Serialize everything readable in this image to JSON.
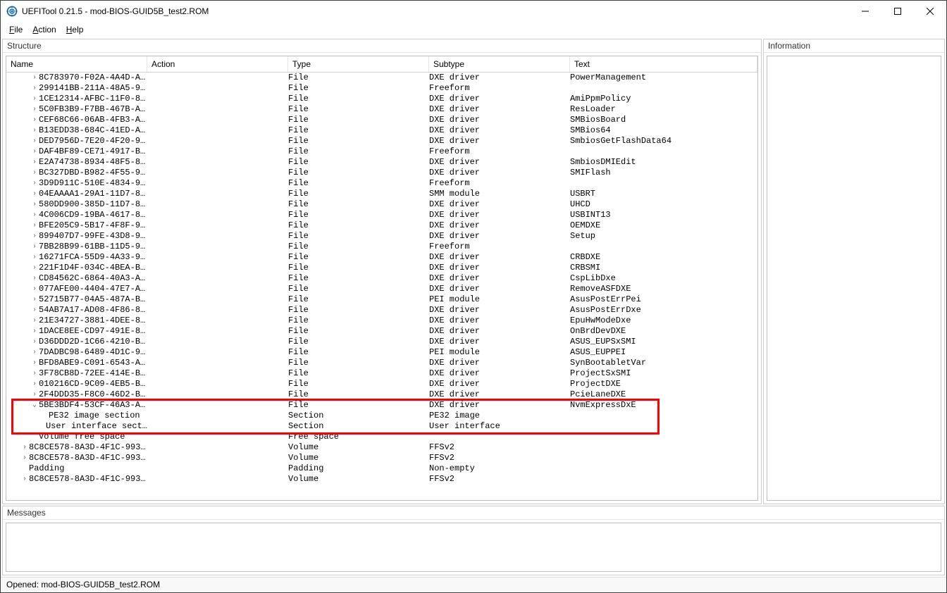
{
  "title": "UEFITool 0.21.5 - mod-BIOS-GUID5B_test2.ROM",
  "menu": {
    "file": "File",
    "action": "Action",
    "help": "Help"
  },
  "panels": {
    "structure": "Structure",
    "information": "Information",
    "messages": "Messages"
  },
  "columns": {
    "name": "Name",
    "action": "Action",
    "type": "Type",
    "subtype": "Subtype",
    "text": "Text"
  },
  "statusbar": "Opened: mod-BIOS-GUID5B_test2.ROM",
  "rows": [
    {
      "indent": 2,
      "twisty": ">",
      "name": "8C783970-F02A-4A4D-A…",
      "type": "File",
      "subtype": "DXE driver",
      "text": "PowerManagement"
    },
    {
      "indent": 2,
      "twisty": ">",
      "name": "299141BB-211A-48A5-9…",
      "type": "File",
      "subtype": "Freeform",
      "text": ""
    },
    {
      "indent": 2,
      "twisty": ">",
      "name": "1CE12314-AFBC-11F0-8…",
      "type": "File",
      "subtype": "DXE driver",
      "text": "AmiPpmPolicy"
    },
    {
      "indent": 2,
      "twisty": ">",
      "name": "5C0FB3B9-F7BB-467B-A…",
      "type": "File",
      "subtype": "DXE driver",
      "text": "ResLoader"
    },
    {
      "indent": 2,
      "twisty": ">",
      "name": "CEF68C66-06AB-4FB3-A…",
      "type": "File",
      "subtype": "DXE driver",
      "text": "SMBiosBoard"
    },
    {
      "indent": 2,
      "twisty": ">",
      "name": "B13EDD38-684C-41ED-A…",
      "type": "File",
      "subtype": "DXE driver",
      "text": "SMBios64"
    },
    {
      "indent": 2,
      "twisty": ">",
      "name": "DED7956D-7E20-4F20-9…",
      "type": "File",
      "subtype": "DXE driver",
      "text": "SmbiosGetFlashData64"
    },
    {
      "indent": 2,
      "twisty": ">",
      "name": "DAF4BF89-CE71-4917-B…",
      "type": "File",
      "subtype": "Freeform",
      "text": ""
    },
    {
      "indent": 2,
      "twisty": ">",
      "name": "E2A74738-8934-48F5-8…",
      "type": "File",
      "subtype": "DXE driver",
      "text": "SmbiosDMIEdit"
    },
    {
      "indent": 2,
      "twisty": ">",
      "name": "BC327DBD-B982-4F55-9…",
      "type": "File",
      "subtype": "DXE driver",
      "text": "SMIFlash"
    },
    {
      "indent": 2,
      "twisty": ">",
      "name": "3D9D911C-510E-4834-9…",
      "type": "File",
      "subtype": "Freeform",
      "text": ""
    },
    {
      "indent": 2,
      "twisty": ">",
      "name": "04EAAAA1-29A1-11D7-8…",
      "type": "File",
      "subtype": "SMM module",
      "text": "USBRT"
    },
    {
      "indent": 2,
      "twisty": ">",
      "name": "580DD900-385D-11D7-8…",
      "type": "File",
      "subtype": "DXE driver",
      "text": "UHCD"
    },
    {
      "indent": 2,
      "twisty": ">",
      "name": "4C006CD9-19BA-4617-8…",
      "type": "File",
      "subtype": "DXE driver",
      "text": "USBINT13"
    },
    {
      "indent": 2,
      "twisty": ">",
      "name": "BFE205C9-5B17-4F8F-9…",
      "type": "File",
      "subtype": "DXE driver",
      "text": "OEMDXE"
    },
    {
      "indent": 2,
      "twisty": ">",
      "name": "899407D7-99FE-43D8-9…",
      "type": "File",
      "subtype": "DXE driver",
      "text": "Setup"
    },
    {
      "indent": 2,
      "twisty": ">",
      "name": "7BB28B99-61BB-11D5-9…",
      "type": "File",
      "subtype": "Freeform",
      "text": ""
    },
    {
      "indent": 2,
      "twisty": ">",
      "name": "16271FCA-55D9-4A33-9…",
      "type": "File",
      "subtype": "DXE driver",
      "text": "CRBDXE"
    },
    {
      "indent": 2,
      "twisty": ">",
      "name": "221F1D4F-034C-4BEA-B…",
      "type": "File",
      "subtype": "DXE driver",
      "text": "CRBSMI"
    },
    {
      "indent": 2,
      "twisty": ">",
      "name": "CD84562C-6864-40A3-A…",
      "type": "File",
      "subtype": "DXE driver",
      "text": "CspLibDxe"
    },
    {
      "indent": 2,
      "twisty": ">",
      "name": "077AFE00-4404-47E7-A…",
      "type": "File",
      "subtype": "DXE driver",
      "text": "RemoveASFDXE"
    },
    {
      "indent": 2,
      "twisty": ">",
      "name": "52715B77-04A5-487A-B…",
      "type": "File",
      "subtype": "PEI module",
      "text": "AsusPostErrPei"
    },
    {
      "indent": 2,
      "twisty": ">",
      "name": "54AB7A17-AD08-4F86-8…",
      "type": "File",
      "subtype": "DXE driver",
      "text": "AsusPostErrDxe"
    },
    {
      "indent": 2,
      "twisty": ">",
      "name": "21E34727-3881-4DEE-8…",
      "type": "File",
      "subtype": "DXE driver",
      "text": "EpuHwModeDxe"
    },
    {
      "indent": 2,
      "twisty": ">",
      "name": "1DACE8EE-CD97-491E-8…",
      "type": "File",
      "subtype": "DXE driver",
      "text": "OnBrdDevDXE"
    },
    {
      "indent": 2,
      "twisty": ">",
      "name": "D36DDD2D-1C66-4210-B…",
      "type": "File",
      "subtype": "DXE driver",
      "text": "ASUS_EUPSxSMI"
    },
    {
      "indent": 2,
      "twisty": ">",
      "name": "7DADBC98-6489-4D1C-9…",
      "type": "File",
      "subtype": "PEI module",
      "text": "ASUS_EUPPEI"
    },
    {
      "indent": 2,
      "twisty": ">",
      "name": "BFD8ABE9-C091-6543-A…",
      "type": "File",
      "subtype": "DXE driver",
      "text": "SynBootabletVar"
    },
    {
      "indent": 2,
      "twisty": ">",
      "name": "3F78CB8D-72EE-414E-B…",
      "type": "File",
      "subtype": "DXE driver",
      "text": "ProjectSxSMI"
    },
    {
      "indent": 2,
      "twisty": ">",
      "name": "010216CD-9C09-4EB5-B…",
      "type": "File",
      "subtype": "DXE driver",
      "text": "ProjectDXE"
    },
    {
      "indent": 2,
      "twisty": ">",
      "name": "2F4DDD35-F8C0-46D2-B…",
      "type": "File",
      "subtype": "DXE driver",
      "text": "PcieLaneDXE"
    },
    {
      "indent": 2,
      "twisty": "v",
      "name": "5BE3BDF4-53CF-46A3-A…",
      "type": "File",
      "subtype": "DXE driver",
      "text": "NvmExpressDxE",
      "hl": true
    },
    {
      "indent": 3,
      "twisty": "",
      "name": "PE32 image section",
      "type": "Section",
      "subtype": "PE32 image",
      "text": "",
      "hl": true
    },
    {
      "indent": 3,
      "twisty": "",
      "name": "User interface sect…",
      "type": "Section",
      "subtype": "User interface",
      "text": "",
      "hl": true
    },
    {
      "indent": 2,
      "twisty": "",
      "name": "Volume free space",
      "type": "Free space",
      "subtype": "",
      "text": ""
    },
    {
      "indent": 1,
      "twisty": ">",
      "name": "8C8CE578-8A3D-4F1C-993…",
      "type": "Volume",
      "subtype": "FFSv2",
      "text": ""
    },
    {
      "indent": 1,
      "twisty": ">",
      "name": "8C8CE578-8A3D-4F1C-993…",
      "type": "Volume",
      "subtype": "FFSv2",
      "text": ""
    },
    {
      "indent": 1,
      "twisty": "",
      "name": "Padding",
      "type": "Padding",
      "subtype": "Non-empty",
      "text": ""
    },
    {
      "indent": 1,
      "twisty": ">",
      "name": "8C8CE578-8A3D-4F1C-993…",
      "type": "Volume",
      "subtype": "FFSv2",
      "text": ""
    }
  ],
  "highlight": {
    "firstIdx": 31,
    "lastIdx": 33
  }
}
